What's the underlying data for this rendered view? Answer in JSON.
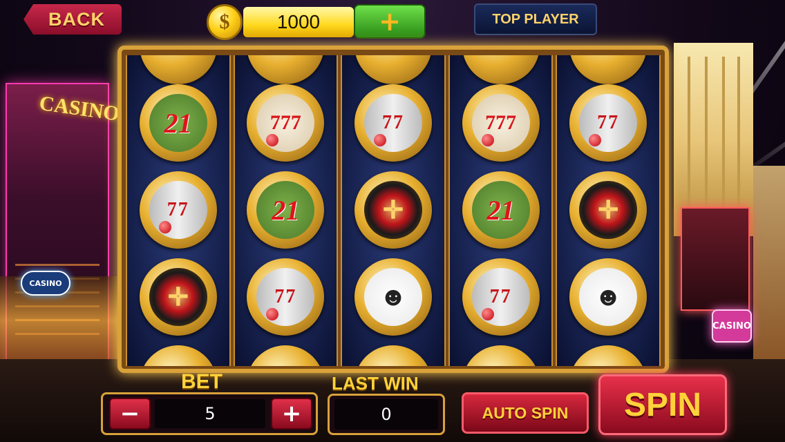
{
  "header": {
    "back_label": "BACK",
    "coin_symbol": "$",
    "balance": "1000",
    "add_coins_label": "+",
    "top_player_label": "TOP PLAYER"
  },
  "background": {
    "left_sign": "CASINO",
    "left_small_sign": "CASINO",
    "right_sign": "CASINO"
  },
  "reels": [
    [
      "sym-21",
      "sym-slot",
      "sym-roulette"
    ],
    [
      "sym-777",
      "sym-21",
      "sym-slot"
    ],
    [
      "sym-slot",
      "sym-roulette",
      "sym-dealer"
    ],
    [
      "sym-777",
      "sym-21",
      "sym-slot"
    ],
    [
      "sym-slot",
      "sym-roulette",
      "sym-dealer"
    ]
  ],
  "symbol_glyphs": {
    "sym-21": "21",
    "sym-777": "777",
    "sym-slot": "77",
    "sym-roulette": "✛",
    "sym-dealer": "☻"
  },
  "controls": {
    "bet_label": "BET",
    "bet_minus": "−",
    "bet_plus": "+",
    "bet_value": "5",
    "last_win_label": "LAST WIN",
    "last_win_value": "0",
    "auto_spin_label": "AUTO SPIN",
    "spin_label": "SPIN"
  },
  "colors": {
    "gold": "#d9a23a",
    "button_red": "#c8284a",
    "label_yellow": "#ffd23a",
    "reel_blue": "#141e48"
  }
}
